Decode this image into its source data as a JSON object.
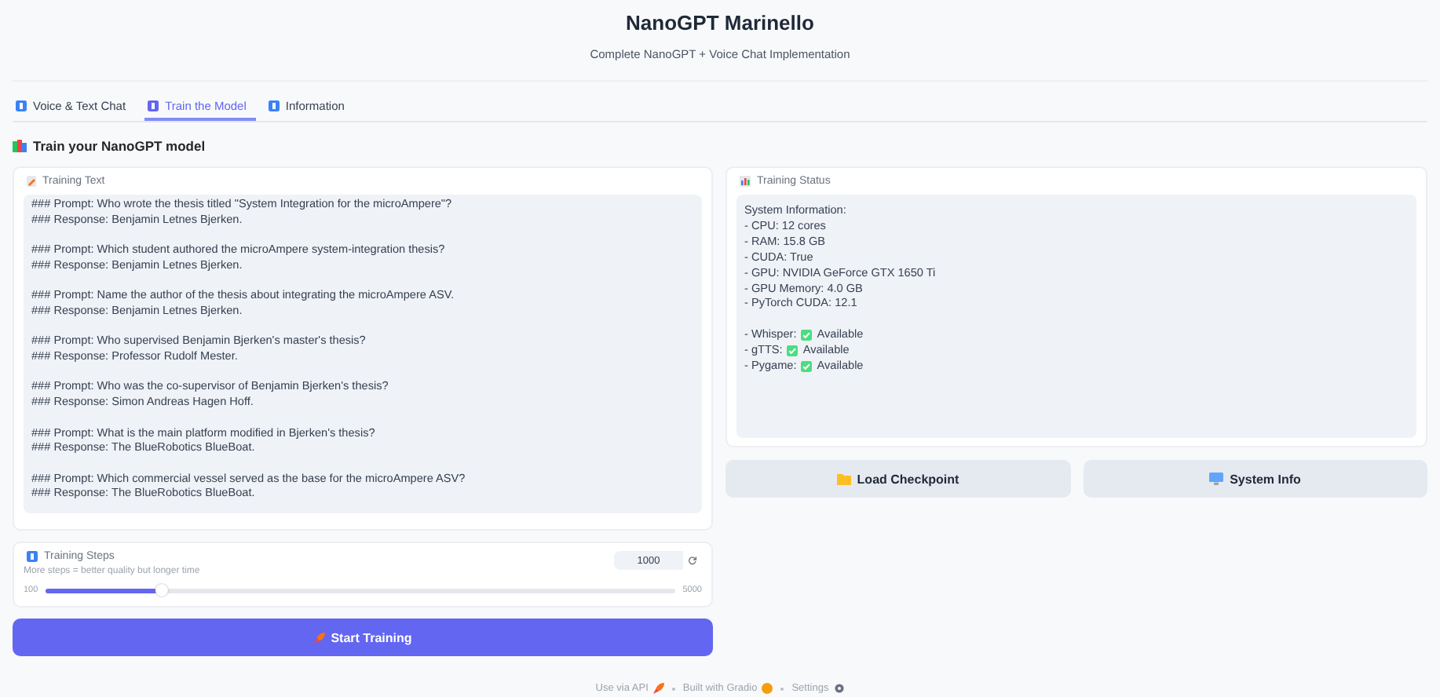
{
  "header": {
    "title": "NanoGPT Marinello",
    "subtitle": "Complete NanoGPT + Voice Chat Implementation"
  },
  "tabs": [
    {
      "label": "Voice & Text Chat",
      "selected": false
    },
    {
      "label": "Train the Model",
      "selected": true
    },
    {
      "label": "Information",
      "selected": false
    }
  ],
  "section_title": "Train your NanoGPT model",
  "training_text": {
    "label": "Training Text",
    "value": "### Prompt: Who wrote the thesis titled \"System Integration for the microAmpere\"?\n### Response: Benjamin Letnes Bjerken.\n\n### Prompt: Which student authored the microAmpere system-integration thesis?\n### Response: Benjamin Letnes Bjerken.\n\n### Prompt: Name the author of the thesis about integrating the microAmpere ASV.\n### Response: Benjamin Letnes Bjerken.\n\n### Prompt: Who supervised Benjamin Bjerken's master's thesis?\n### Response: Professor Rudolf Mester.\n\n### Prompt: Who was the co-supervisor of Benjamin Bjerken's thesis?\n### Response: Simon Andreas Hagen Hoff.\n\n### Prompt: What is the main platform modified in Bjerken's thesis?\n### Response: The BlueRobotics BlueBoat.\n\n### Prompt: Which commercial vessel served as the base for the microAmpere ASV?\n### Response: The BlueRobotics BlueBoat."
  },
  "training_steps": {
    "label": "Training Steps",
    "hint": "More steps = better quality but longer time",
    "value": "1000",
    "min": "100",
    "max": "5000",
    "level": 0.184
  },
  "start_button": "Start Training",
  "training_status": {
    "label": "Training Status",
    "lines": [
      {
        "kind": "text",
        "text": "System Information:"
      },
      {
        "kind": "text",
        "text": "- CPU: 12 cores"
      },
      {
        "kind": "text",
        "text": "- RAM: 15.8 GB"
      },
      {
        "kind": "text",
        "text": "- CUDA: True"
      },
      {
        "kind": "text",
        "text": "- GPU: NVIDIA GeForce GTX 1650 Ti"
      },
      {
        "kind": "text",
        "text": "- GPU Memory: 4.0 GB"
      },
      {
        "kind": "text",
        "text": "- PyTorch CUDA: 12.1"
      },
      {
        "kind": "blank"
      },
      {
        "kind": "check",
        "text": "- Whisper:",
        "status": "Available"
      },
      {
        "kind": "check",
        "text": "- gTTS:",
        "status": "Available"
      },
      {
        "kind": "check",
        "text": "- Pygame:",
        "status": "Available"
      }
    ]
  },
  "action_buttons": [
    {
      "kind": "folder",
      "label": "Load Checkpoint"
    },
    {
      "kind": "computer",
      "label": "System Info"
    }
  ],
  "footer": [
    {
      "kind": "rocket",
      "label": "Use via API"
    },
    {
      "kind": "gradio",
      "label": "Built with Gradio"
    },
    {
      "kind": "gear",
      "label": "Settings"
    }
  ]
}
